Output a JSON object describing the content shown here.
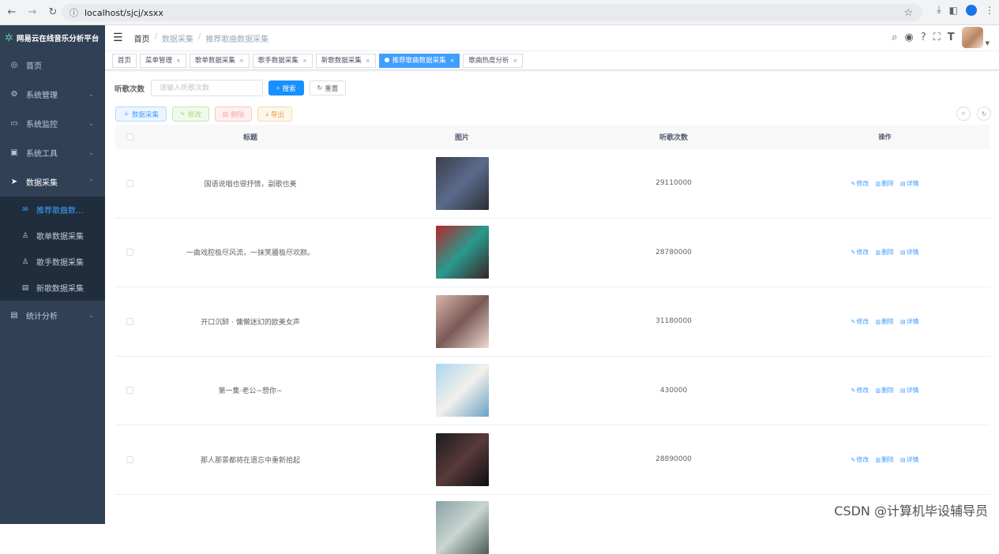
{
  "browser": {
    "url": "localhost/sjcj/xsxx",
    "back_icon": "arrow-left-icon",
    "forward_icon": "arrow-right-icon",
    "reload_icon": "reload-icon"
  },
  "sidebar": {
    "title": "网易云在线音乐分析平台",
    "items": [
      {
        "label": "首页",
        "icon": "dashboard-icon"
      },
      {
        "label": "系统管理",
        "icon": "gear-icon"
      },
      {
        "label": "系统监控",
        "icon": "monitor-icon"
      },
      {
        "label": "系统工具",
        "icon": "toolbox-icon"
      },
      {
        "label": "数据采集",
        "icon": "send-icon"
      },
      {
        "label": "统计分析",
        "icon": "chart-icon"
      }
    ],
    "submenu": [
      {
        "label": "推荐歌曲数...",
        "icon": "mail-icon"
      },
      {
        "label": "歌单数据采集",
        "icon": "user-icon"
      },
      {
        "label": "歌手数据采集",
        "icon": "user-icon"
      },
      {
        "label": "新歌数据采集",
        "icon": "doc-icon"
      }
    ]
  },
  "header": {
    "breadcrumb": [
      "首页",
      "数据采集",
      "推荐歌曲数据采集"
    ]
  },
  "tags": [
    {
      "label": "首页",
      "closable": false,
      "active": false
    },
    {
      "label": "菜单管理",
      "closable": true,
      "active": false
    },
    {
      "label": "歌单数据采集",
      "closable": true,
      "active": false
    },
    {
      "label": "歌手数据采集",
      "closable": true,
      "active": false
    },
    {
      "label": "新歌数据采集",
      "closable": true,
      "active": false
    },
    {
      "label": "推荐歌曲数据采集",
      "closable": true,
      "active": true
    },
    {
      "label": "歌曲热度分析",
      "closable": true,
      "active": false
    }
  ],
  "search": {
    "label": "听歌次数",
    "placeholder": "请输入听歌次数",
    "search_btn": "搜索",
    "reset_btn": "重置"
  },
  "toolbar": {
    "collect": "数据采集",
    "edit": "修改",
    "delete": "删除",
    "export": "导出"
  },
  "table": {
    "columns": [
      "标题",
      "图片",
      "听歌次数",
      "操作"
    ],
    "ops": [
      "修改",
      "删除",
      "详情"
    ],
    "rows": [
      {
        "title": "国语说唱也很抒情，副歌也美",
        "count": "29110000",
        "img": [
          "#3a3f4a",
          "#5a6b8c",
          "#2b2f36"
        ]
      },
      {
        "title": "一曲戏腔极尽风流，一抹笑靥极尽欢颜。",
        "count": "28780000",
        "img": [
          "#b2272a",
          "#2a9a8f",
          "#3b2324"
        ]
      },
      {
        "title": "开口沉醉 · 慵懒迷幻的欧美女声",
        "count": "31180000",
        "img": [
          "#d8b5ac",
          "#7a5a55",
          "#efd9d2"
        ]
      },
      {
        "title": "第一集·老公~想你~",
        "count": "430000",
        "img": [
          "#a9d6f0",
          "#f3f0ea",
          "#6aa1c9"
        ]
      },
      {
        "title": "那人那景都将在遗忘中重新拾起",
        "count": "28890000",
        "img": [
          "#1b1b1d",
          "#5a3a3a",
          "#0e0e10"
        ]
      },
      {
        "title": "",
        "count": "",
        "img": [
          "#8aa2a8",
          "#c9d5d0",
          "#4a5c5a"
        ]
      }
    ]
  },
  "watermark": "CSDN @计算机毕设辅导员"
}
